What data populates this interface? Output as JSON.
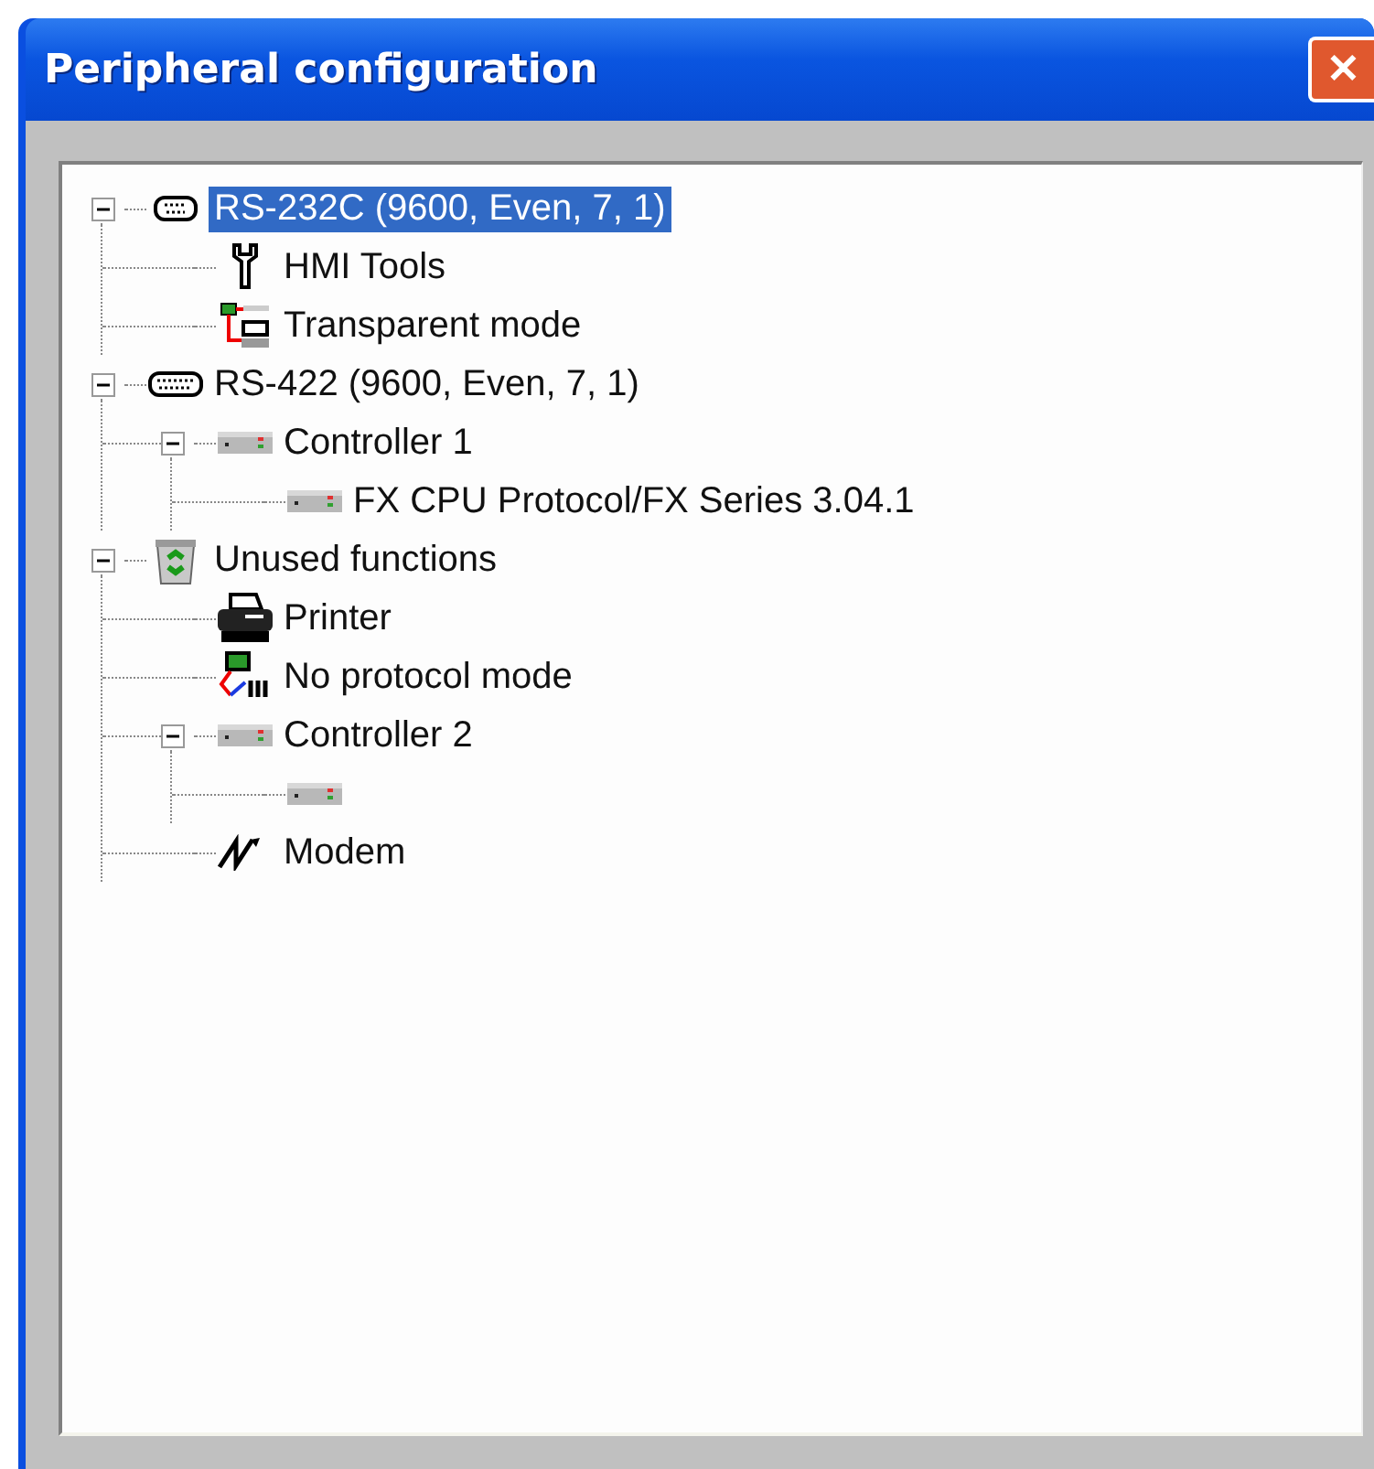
{
  "window": {
    "title": "Peripheral configuration",
    "close": "✕"
  },
  "tree": [
    {
      "label": "RS-232C  (9600, Even, 7, 1)",
      "kind": "serial-small",
      "selected": true,
      "expanded": true,
      "children": [
        {
          "label": "HMI Tools",
          "kind": "wrench",
          "selected": false
        },
        {
          "label": "Transparent mode",
          "kind": "transparent",
          "selected": false
        }
      ]
    },
    {
      "label": "RS-422  (9600, Even, 7, 1)",
      "kind": "serial-wide",
      "selected": false,
      "expanded": true,
      "children": [
        {
          "label": "Controller 1",
          "kind": "controller",
          "selected": false,
          "expanded": true,
          "children": [
            {
              "label": "FX CPU Protocol/FX Series 3.04.1",
              "kind": "controller",
              "selected": false
            }
          ]
        }
      ]
    },
    {
      "label": "Unused functions",
      "kind": "bin",
      "selected": false,
      "expanded": true,
      "children": [
        {
          "label": "Printer",
          "kind": "printer",
          "selected": false
        },
        {
          "label": "No protocol mode",
          "kind": "no-protocol",
          "selected": false
        },
        {
          "label": "Controller 2",
          "kind": "controller",
          "selected": false,
          "expanded": true,
          "children": [
            {
              "kind": "controller"
            }
          ]
        },
        {
          "label": "Modem",
          "kind": "modem",
          "selected": false
        }
      ]
    }
  ]
}
